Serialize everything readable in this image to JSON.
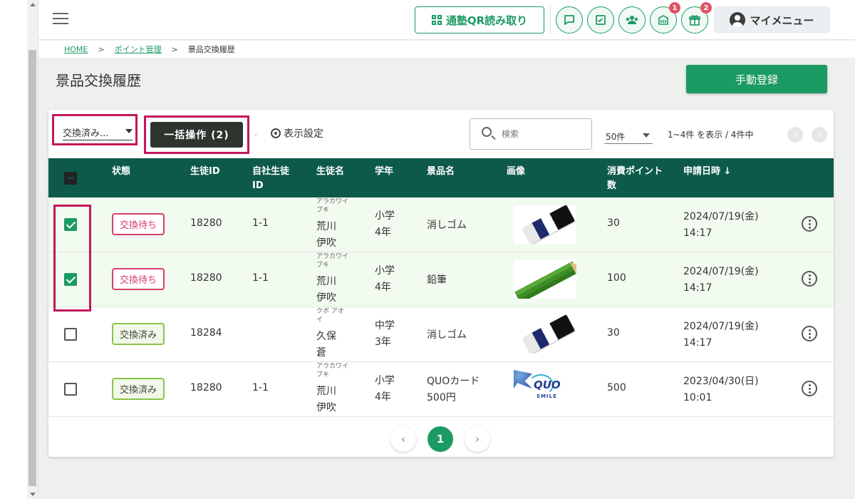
{
  "header": {
    "qr_button": "通塾QR読み取り",
    "my_menu": "マイメニュー",
    "badges": {
      "school": "1",
      "gift": "2"
    }
  },
  "breadcrumb": {
    "home": "HOME",
    "sep": ">",
    "points": "ポイント管理",
    "current": "景品交換履歴"
  },
  "page": {
    "title": "景品交換履歴",
    "manual_button": "手動登録"
  },
  "toolbar": {
    "status_filter": "交換済み...",
    "bulk_button": "一括操作 (2)",
    "display_settings": "表示設定",
    "search_placeholder": "検索",
    "per_page": "50件",
    "range": "1~4件 を表示 / 4件中"
  },
  "table": {
    "headers": {
      "status": "状態",
      "student_id": "生徒ID",
      "own_id": "自社生徒ID",
      "name": "生徒名",
      "grade": "学年",
      "prize": "景品名",
      "image": "画像",
      "points": "消費ポイント数",
      "date": "申請日時"
    },
    "rows": [
      {
        "checked": true,
        "status": "交換待ち",
        "student_id": "18280",
        "own_id": "1-1",
        "kana": "アラカワイブキ",
        "name": "荒川伊吹",
        "grade": "小学4年",
        "prize": "消しゴム",
        "image": "eraser",
        "points": "30",
        "date": "2024/07/19(金)",
        "time": "14:17"
      },
      {
        "checked": true,
        "status": "交換待ち",
        "student_id": "18280",
        "own_id": "1-1",
        "kana": "アラカワイブキ",
        "name": "荒川伊吹",
        "grade": "小学4年",
        "prize": "鉛筆",
        "image": "pencil",
        "points": "100",
        "date": "2024/07/19(金)",
        "time": "14:17"
      },
      {
        "checked": false,
        "status": "交換済み",
        "student_id": "18284",
        "own_id": "",
        "kana": "クボ アオイ",
        "name": "久保蒼",
        "grade": "中学3年",
        "prize": "消しゴム",
        "image": "eraser",
        "points": "30",
        "date": "2024/07/19(金)",
        "time": "14:17"
      },
      {
        "checked": false,
        "status": "交換済み",
        "student_id": "18280",
        "own_id": "1-1",
        "kana": "アラカワイブキ",
        "name": "荒川伊吹",
        "grade": "小学4年",
        "prize": "QUOカード500円",
        "image": "quo-card",
        "points": "500",
        "date": "2023/04/30(日)",
        "time": "10:01"
      }
    ]
  },
  "pagination": {
    "current": "1",
    "prev": "‹",
    "next": "›"
  },
  "colors": {
    "brand": "#1b9a64",
    "header_bg": "#0d5a4a",
    "highlight": "#c2185b",
    "waiting": "#d53f68",
    "done": "#8bc34a"
  }
}
